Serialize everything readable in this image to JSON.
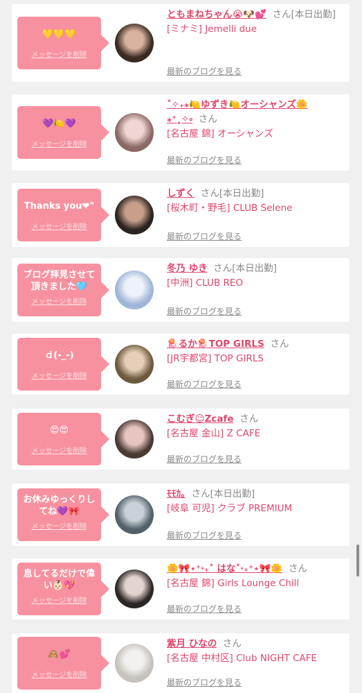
{
  "delete_label": "メッセージを削除",
  "blog_label": "最新のブログを見る",
  "san": "さん",
  "items": [
    {
      "message": "💛💛💛",
      "name": "ともまねちゃん😭🐶💕",
      "status": "[本日出勤]",
      "shop": "[ミナミ] Jemelli due",
      "avatar_colors": [
        "#3a2a22",
        "#d9b3a0"
      ]
    },
    {
      "message": "💜🍋💜",
      "name": "˚✧₊⁎🍋ゆずき🍋オーシャンズ🌼⁎⁺˳✧༚",
      "status": "",
      "shop": "[名古屋 錦] オーシャンズ",
      "avatar_colors": [
        "#8a6a66",
        "#f0d6d2"
      ]
    },
    {
      "message": "Thanks you❤\"",
      "name": "しずく",
      "status": "[本日出勤]",
      "shop": "[桜木町・野毛] CLUB Selene",
      "avatar_colors": [
        "#2b2320",
        "#c8a08a"
      ]
    },
    {
      "message": "ブログ拝見させて頂きました🩵",
      "name": "冬乃 ゆき",
      "status": "[本日出勤]",
      "shop": "[中洲] CLUB REO",
      "avatar_colors": [
        "#9fb6d8",
        "#eef2fa"
      ]
    },
    {
      "message": "ｄ(-_-)",
      "name": "🪼るか🪼TOP GIRLS",
      "status": "",
      "shop": "[JR宇都宮] TOP GIRLS",
      "avatar_colors": [
        "#6d5a3e",
        "#e6cfb8"
      ]
    },
    {
      "message": "😍😍",
      "name": "こむぎ☺Zcafe",
      "status": "",
      "shop": "[名古屋 金山] Z CAFE",
      "avatar_colors": [
        "#4a3a34",
        "#e8c5c0"
      ]
    },
    {
      "message": "お休みゆっくりしてね💜🎀",
      "name": "ﾓﾓｶ｡",
      "status": "[本日出勤]",
      "shop": "[岐阜 可児] クラブ PREMIUM",
      "avatar_colors": [
        "#52606a",
        "#c9d2d6"
      ]
    },
    {
      "message": "息してるだけで偉い👶🏻💖",
      "name": "🌼🎀⋆⁺‧₊˚ はな˚‧₊⁺⋆🎀🌼",
      "status": "",
      "shop": "[名古屋 錦] Girls Lounge Chill",
      "avatar_colors": [
        "#2a2624",
        "#e4d4cf"
      ]
    },
    {
      "message": "🙈💕",
      "name": "紫月 ひなの",
      "status": "",
      "shop": "[名古屋 中村区] Club NIGHT CAFE",
      "avatar_colors": [
        "#c7c2bd",
        "#f3f1ef"
      ]
    }
  ]
}
